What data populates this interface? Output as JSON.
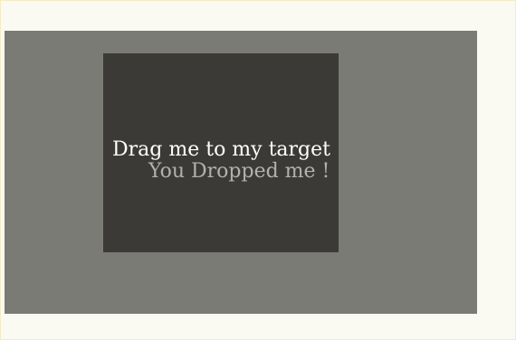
{
  "drag_item": {
    "label": "Drag me to my target"
  },
  "drop_target": {
    "label": "You Dropped me !"
  }
}
